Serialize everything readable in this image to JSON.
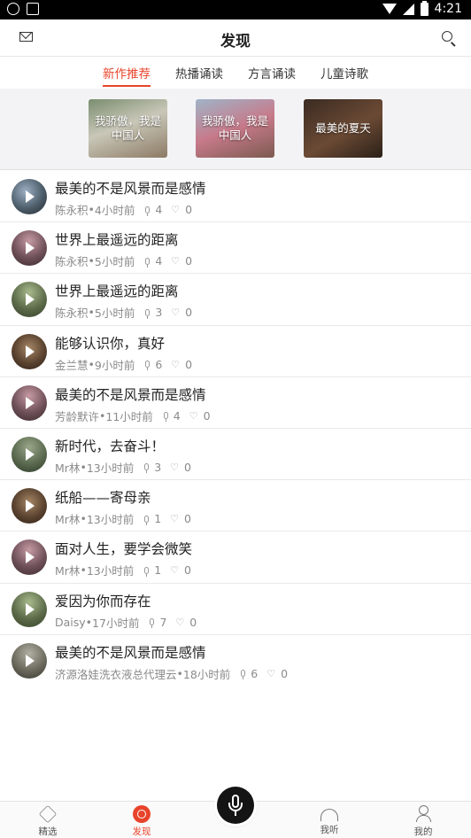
{
  "status_bar": {
    "time": "4:21"
  },
  "header": {
    "title": "发现",
    "left_icon": "mail-icon",
    "right_icon": "search-icon"
  },
  "tabs": [
    {
      "label": "新作推荐",
      "active": true
    },
    {
      "label": "热播诵读",
      "active": false
    },
    {
      "label": "方言诵读",
      "active": false
    },
    {
      "label": "儿童诗歌",
      "active": false
    }
  ],
  "banners": [
    {
      "text": "我骄傲，我是中国人"
    },
    {
      "text": "我骄傲，我是中国人"
    },
    {
      "text": "最美的夏天"
    }
  ],
  "items": [
    {
      "title": "最美的不是风景而是感情",
      "author": "陈永积",
      "time": "4小时前",
      "listens": "4",
      "likes": "0"
    },
    {
      "title": "世界上最遥远的距离",
      "author": "陈永积",
      "time": "5小时前",
      "listens": "4",
      "likes": "0"
    },
    {
      "title": "世界上最遥远的距离",
      "author": "陈永积",
      "time": "5小时前",
      "listens": "3",
      "likes": "0"
    },
    {
      "title": "能够认识你，真好",
      "author": "金兰慧",
      "time": "9小时前",
      "listens": "6",
      "likes": "0"
    },
    {
      "title": "最美的不是风景而是感情",
      "author": "芳龄默许",
      "time": "11小时前",
      "listens": "4",
      "likes": "0"
    },
    {
      "title": "新时代，去奋斗！",
      "author": "Mr林",
      "time": "13小时前",
      "listens": "3",
      "likes": "0"
    },
    {
      "title": "纸船——寄母亲",
      "author": "Mr林",
      "time": "13小时前",
      "listens": "1",
      "likes": "0"
    },
    {
      "title": "面对人生，要学会微笑",
      "author": "Mr林",
      "time": "13小时前",
      "listens": "1",
      "likes": "0"
    },
    {
      "title": "爱因为你而存在",
      "author": "Daisy",
      "time": "17小时前",
      "listens": "7",
      "likes": "0"
    },
    {
      "title": "最美的不是风景而是感情",
      "author": "济源洛娃洗衣液总代理云",
      "time": "18小时前",
      "listens": "6",
      "likes": "0"
    }
  ],
  "bottom_nav": [
    {
      "label": "精选",
      "icon": "diamond-icon",
      "active": false
    },
    {
      "label": "发现",
      "icon": "discover-icon",
      "active": true
    },
    {
      "label": "",
      "icon": "mic-icon",
      "active": false
    },
    {
      "label": "我听",
      "icon": "headset-icon",
      "active": false
    },
    {
      "label": "我的",
      "icon": "user-icon",
      "active": false
    }
  ],
  "accent_color": "#e8442b"
}
